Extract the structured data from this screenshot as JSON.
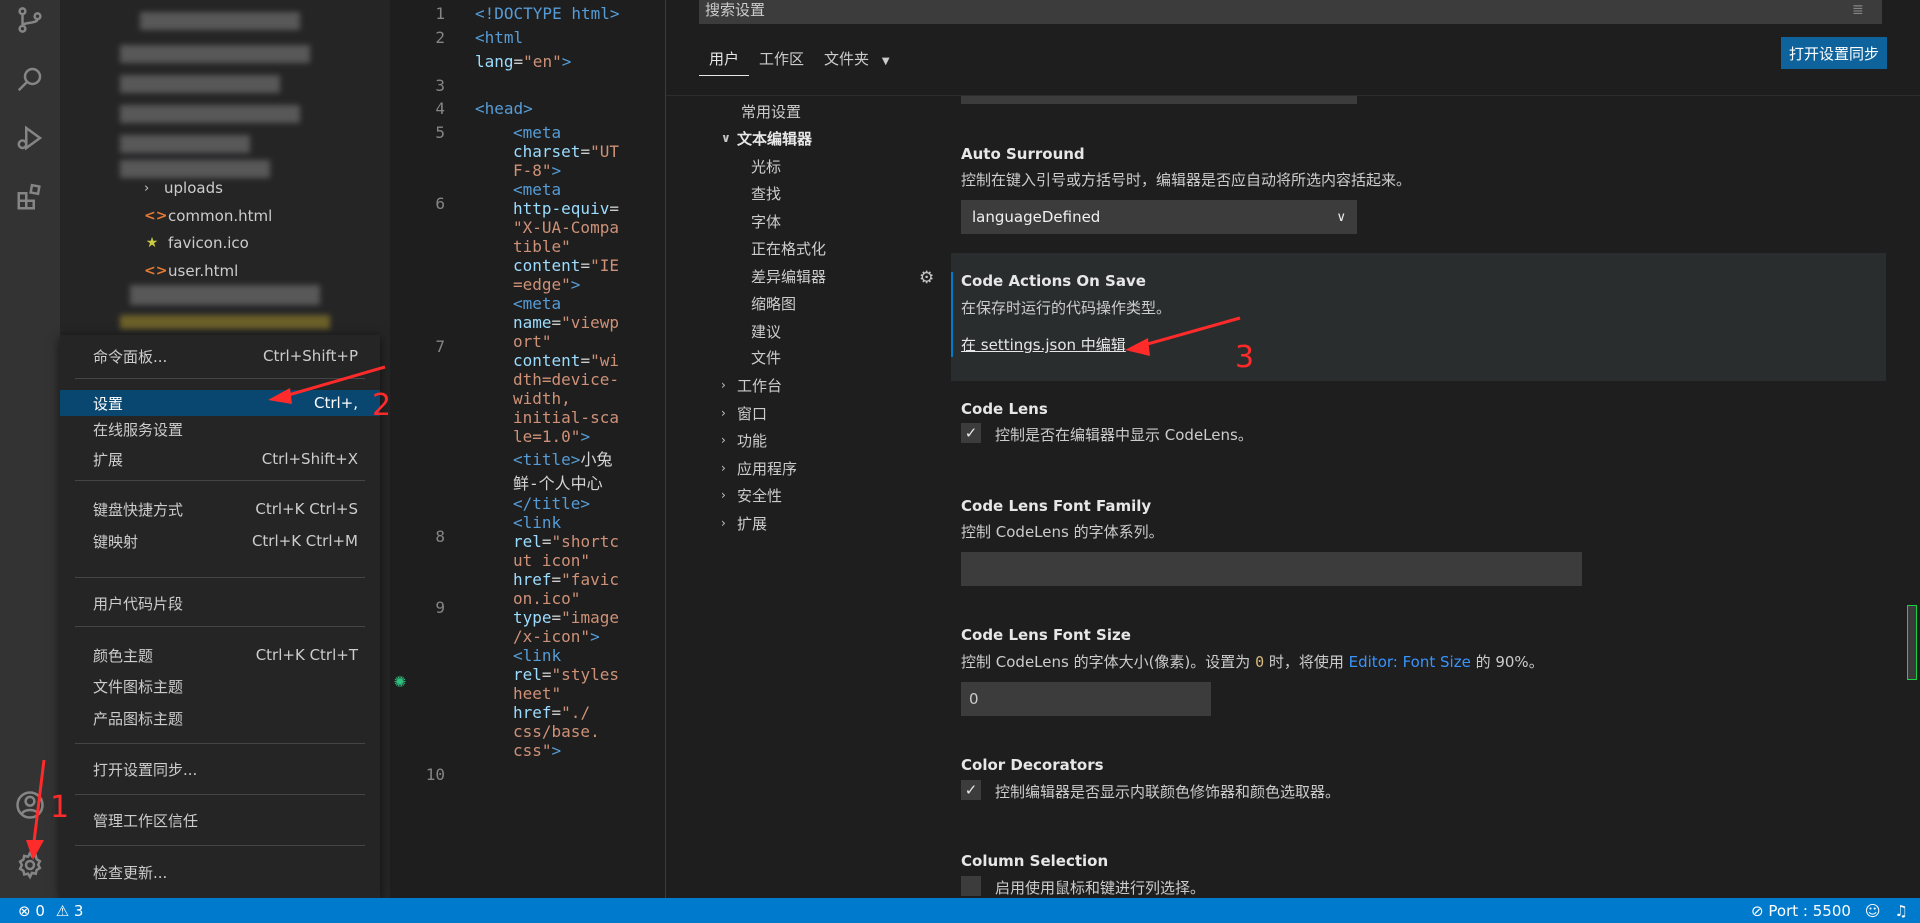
{
  "explorer": {
    "items": [
      {
        "label": "uploads",
        "type": "folder"
      },
      {
        "label": "common.html",
        "type": "html"
      },
      {
        "label": "favicon.ico",
        "type": "star"
      },
      {
        "label": "user.html",
        "type": "html"
      }
    ]
  },
  "menu": {
    "items": [
      {
        "label": "命令面板...",
        "shortcut": "Ctrl+Shift+P"
      },
      {
        "label": "设置",
        "shortcut": "Ctrl+,"
      },
      {
        "label": "在线服务设置",
        "shortcut": ""
      },
      {
        "label": "扩展",
        "shortcut": "Ctrl+Shift+X"
      },
      {
        "label": "键盘快捷方式",
        "shortcut": "Ctrl+K Ctrl+S"
      },
      {
        "label": "键映射",
        "shortcut": "Ctrl+K Ctrl+M"
      },
      {
        "label": "用户代码片段",
        "shortcut": ""
      },
      {
        "label": "颜色主题",
        "shortcut": "Ctrl+K Ctrl+T"
      },
      {
        "label": "文件图标主题",
        "shortcut": ""
      },
      {
        "label": "产品图标主题",
        "shortcut": ""
      },
      {
        "label": "打开设置同步...",
        "shortcut": ""
      },
      {
        "label": "管理工作区信任",
        "shortcut": ""
      },
      {
        "label": "检查更新...",
        "shortcut": ""
      }
    ]
  },
  "editor": {
    "line_numbers": [
      "1",
      "2",
      "3",
      "4",
      "5",
      "6",
      "7",
      "8",
      "9",
      "10"
    ]
  },
  "settings": {
    "search_placeholder": "搜索设置",
    "tabs": [
      "用户",
      "工作区",
      "文件夹"
    ],
    "sync_button": "打开设置同步",
    "toc": {
      "common": "常用设置",
      "text_editor": "文本编辑器",
      "sub": [
        "光标",
        "查找",
        "字体",
        "正在格式化",
        "差异编辑器",
        "缩略图",
        "建议",
        "文件"
      ],
      "groups": [
        "工作台",
        "窗口",
        "功能",
        "应用程序",
        "安全性",
        "扩展"
      ]
    },
    "auto_surround": {
      "title": "Auto Surround",
      "desc": "控制在键入引号或方括号时，编辑器是否应自动将所选内容括起来。",
      "value": "languageDefined"
    },
    "code_actions": {
      "title": "Code Actions On Save",
      "desc": "在保存时运行的代码操作类型。",
      "edit_link": "在 settings.json 中编辑"
    },
    "code_lens": {
      "title": "Code Lens",
      "desc": "控制是否在编辑器中显示 CodeLens。"
    },
    "code_lens_font_family": {
      "title": "Code Lens Font Family",
      "desc": "控制 CodeLens 的字体系列。",
      "value": ""
    },
    "code_lens_font_size": {
      "title": "Code Lens Font Size",
      "desc_pre": "控制 CodeLens 的字体大小(像素)。设置为 ",
      "desc_code": "0",
      "desc_mid": " 时，将使用 ",
      "desc_link": "Editor: Font Size",
      "desc_post": " 的 90%。",
      "value": "0"
    },
    "color_decorators": {
      "title": "Color Decorators",
      "desc": "控制编辑器是否显示内联颜色修饰器和颜色选取器。"
    },
    "column_selection": {
      "title": "Column Selection",
      "desc": "启用使用鼠标和键进行列选择。"
    }
  },
  "statusbar": {
    "errors": "0",
    "warnings": "3",
    "port": "Port : 5500"
  },
  "annotations": [
    "1",
    "2",
    "3"
  ],
  "colors": {
    "accent": "#007acc",
    "menu_highlight": "#094771",
    "annotation": "#ff2a2a"
  }
}
